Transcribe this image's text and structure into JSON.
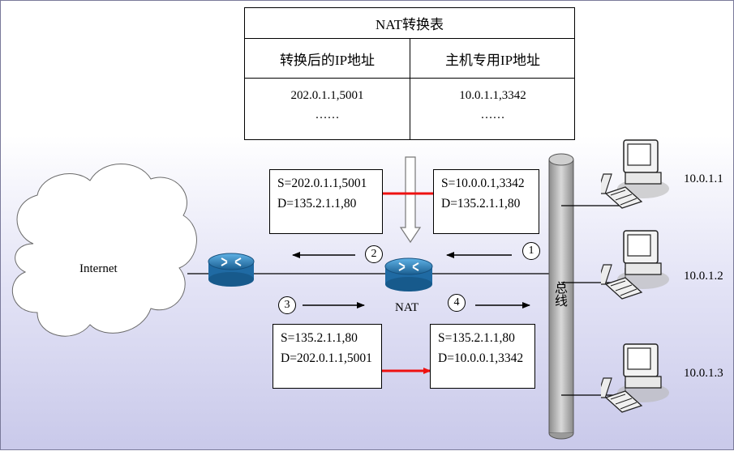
{
  "nat_table": {
    "title": "NAT转换表",
    "col_translated": "转换后的IP地址",
    "col_private": "主机专用IP地址",
    "translated_entry": "202.0.1.1,5001",
    "translated_more": "……",
    "private_entry": "10.0.1.1,3342",
    "private_more": "……"
  },
  "packets": {
    "out_before": {
      "src": "S=10.0.0.1,3342",
      "dst": "D=135.2.1.1,80"
    },
    "out_after": {
      "src": "S=202.0.1.1,5001",
      "dst": "D=135.2.1.1,80"
    },
    "in_before": {
      "src": "S=135.2.1.1,80",
      "dst": "D=202.0.1.1,5001"
    },
    "in_after": {
      "src": "S=135.2.1.1,80",
      "dst": "D=10.0.0.1,3342"
    }
  },
  "steps": [
    "1",
    "2",
    "3",
    "4"
  ],
  "internet_label": "Internet",
  "nat_label": "NAT",
  "bus_label": "总线",
  "hosts": [
    "10.0.1.1",
    "10.0.1.2",
    "10.0.1.3"
  ],
  "colors": {
    "translation_arrow": "#ee1111",
    "router_blue": "#2a7ab8",
    "bus_gray": "#a6a6a6"
  }
}
